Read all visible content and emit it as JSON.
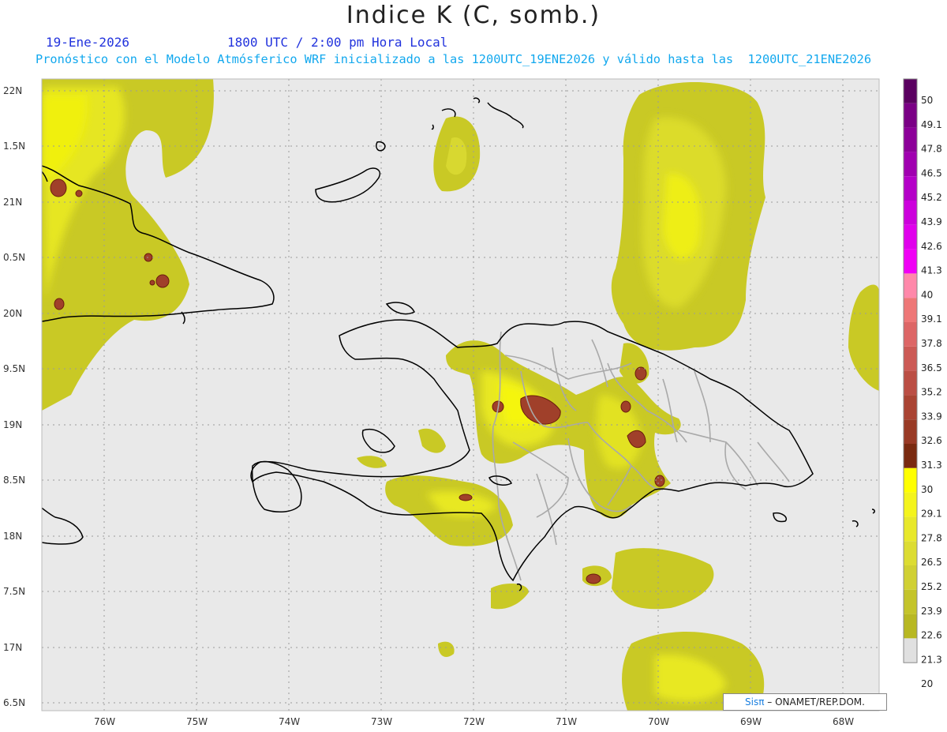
{
  "header": {
    "title": "Indice K (C, somb.)",
    "date": "19-Ene-2026",
    "time": "1800 UTC / 2:00 pm Hora Local",
    "description": "Pronóstico con el Modelo Atmósferico WRF inicializado a las 1200UTC_19ENE2026 y válido hasta las  1200UTC_21ENE2026"
  },
  "map": {
    "lat_labels": [
      "22N",
      "1.5N",
      "21N",
      "0.5N",
      "20N",
      "9.5N",
      "19N",
      "8.5N",
      "18N",
      "7.5N",
      "17N",
      "6.5N"
    ],
    "lon_labels": [
      "76W",
      "75W",
      "74W",
      "73W",
      "72W",
      "71W",
      "70W",
      "69W",
      "68W"
    ],
    "background_color": "#e9e9e9",
    "coastline_color": "#000000",
    "border_color": "#a9a9a9"
  },
  "colorbar": {
    "labels": [
      "50",
      "49.1",
      "47.8",
      "46.5",
      "45.2",
      "43.9",
      "42.6",
      "41.3",
      "40",
      "39.1",
      "37.8",
      "36.5",
      "35.2",
      "33.9",
      "32.6",
      "31.3",
      "30",
      "29.1",
      "27.8",
      "26.5",
      "25.2",
      "23.9",
      "22.6",
      "21.3",
      "20"
    ],
    "colors": [
      "#5a0060",
      "#7a0085",
      "#8c0099",
      "#a000b0",
      "#b400c8",
      "#cc00dc",
      "#e000ec",
      "#f000f5",
      "#ff88aa",
      "#ee7777",
      "#dd6666",
      "#cc5a55",
      "#bb4e44",
      "#aa4433",
      "#993a25",
      "#7a2a10",
      "#ffff00",
      "#f4f41c",
      "#e8e82a",
      "#dcdc32",
      "#d0d033",
      "#c4c42a",
      "#b8b822",
      "#e0e0e0"
    ]
  },
  "credit": {
    "logo": "Sis",
    "pi": "π",
    "text": "– ONAMET/REP.DOM."
  }
}
